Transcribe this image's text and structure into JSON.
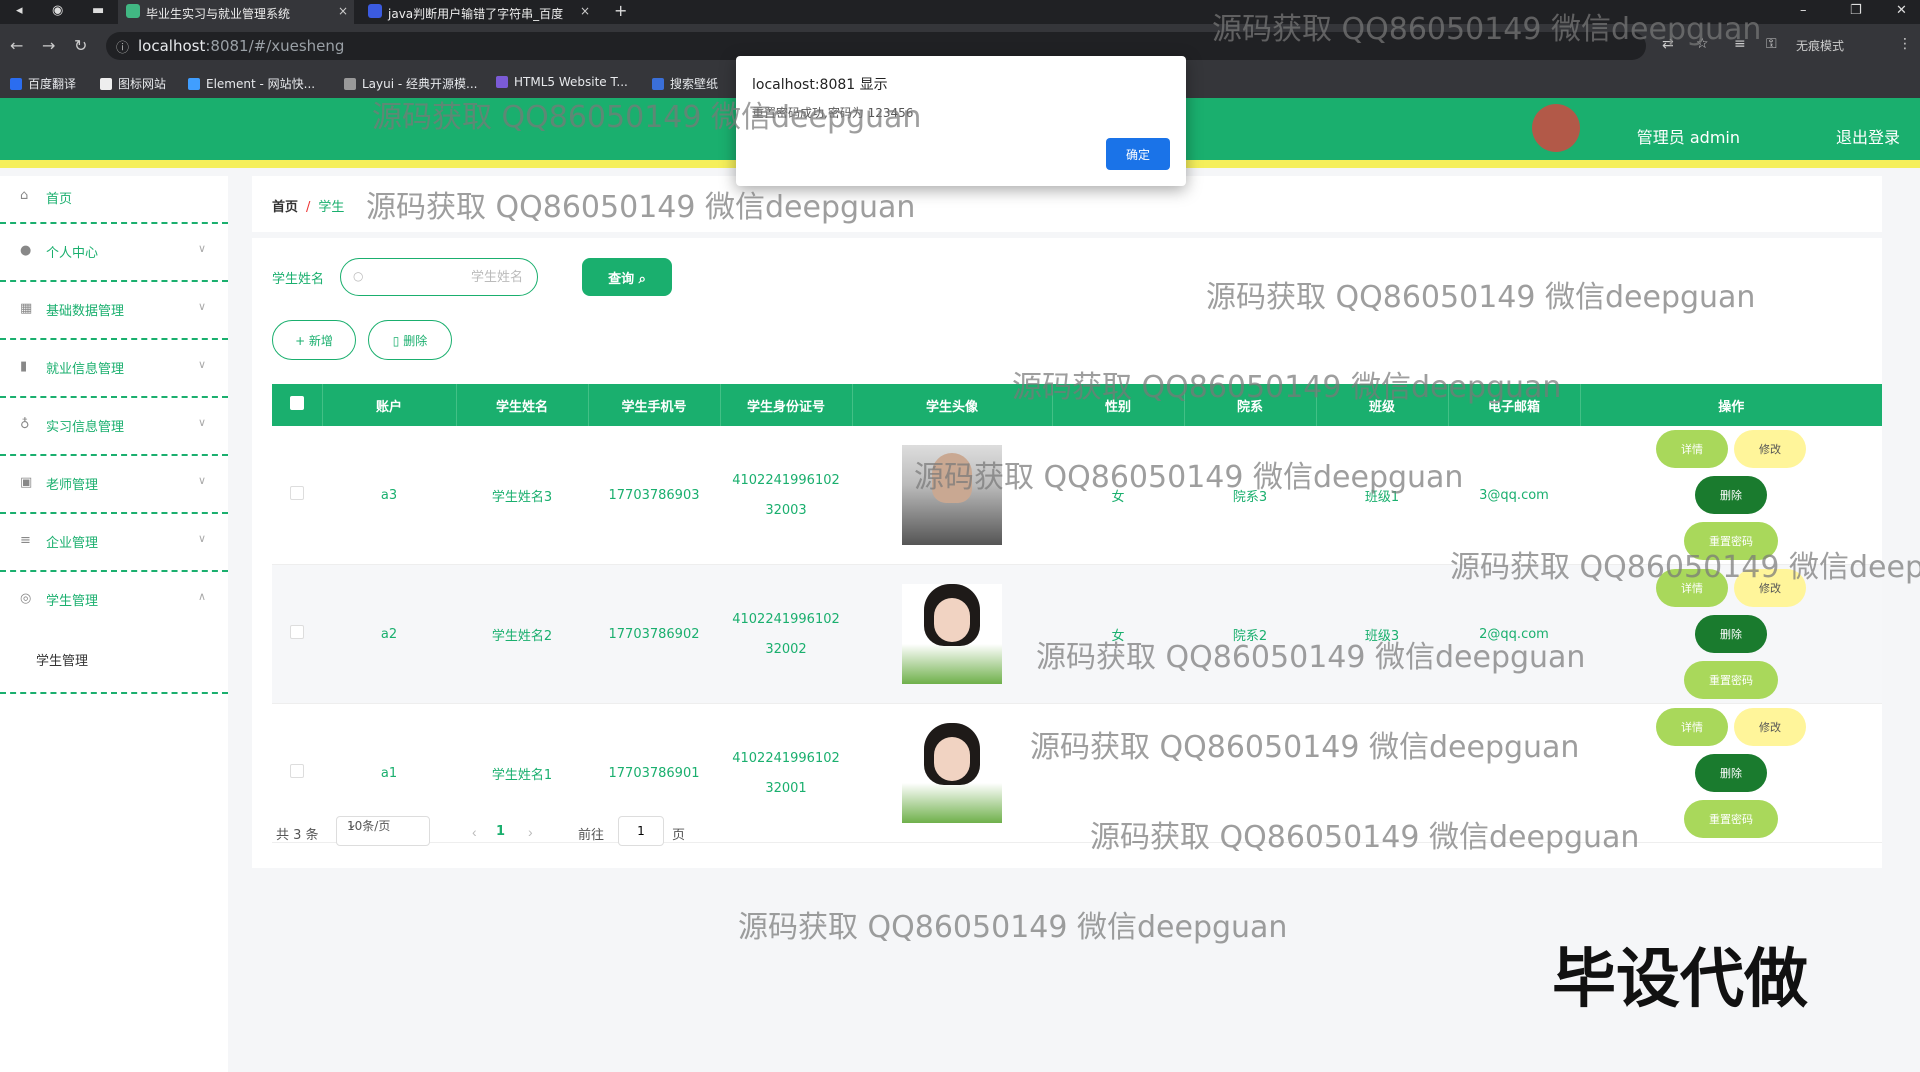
{
  "browser": {
    "tabs": [
      {
        "label": "毕业生实习与就业管理系统",
        "close": "×"
      },
      {
        "label": "java判断用户输错了字符串_百度",
        "close": "×"
      }
    ],
    "new_tab": "+",
    "url_host": "localhost",
    "url_rest": ":8081/#/xuesheng",
    "incognito": "无痕模式",
    "bookmarks": [
      "百度翻译",
      "图标网站",
      "Element - 网站快...",
      "Layui - 经典开源模...",
      "HTML5 Website T...",
      "搜索壁纸"
    ]
  },
  "alert": {
    "title": "localhost:8081 显示",
    "message": "重置密码成功,密码为 123456",
    "ok_label": "确定"
  },
  "header": {
    "user_label": "管理员 admin",
    "logout_label": "退出登录"
  },
  "sidebar": {
    "items": [
      {
        "label": "首页",
        "icon": "home-icon"
      },
      {
        "label": "个人中心",
        "icon": "user-icon"
      },
      {
        "label": "基础数据管理",
        "icon": "data-icon"
      },
      {
        "label": "就业信息管理",
        "icon": "chart-icon"
      },
      {
        "label": "实习信息管理",
        "icon": "mic-icon"
      },
      {
        "label": "老师管理",
        "icon": "teacher-icon"
      },
      {
        "label": "企业管理",
        "icon": "menu-icon"
      },
      {
        "label": "学生管理",
        "icon": "student-icon"
      }
    ],
    "sub_item": "学生管理"
  },
  "breadcrumb": {
    "home": "首页",
    "separator": "/",
    "current": "学生"
  },
  "search": {
    "label": "学生姓名",
    "placeholder": "学生姓名",
    "button": "查询"
  },
  "actions": {
    "add": "+ 新增",
    "delete": "删除"
  },
  "table": {
    "columns": [
      "账户",
      "学生姓名",
      "学生手机号",
      "学生身份证号",
      "学生头像",
      "性别",
      "院系",
      "班级",
      "电子邮箱",
      "操作"
    ],
    "rows": [
      {
        "account": "a3",
        "name": "学生姓名3",
        "phone": "17703786903",
        "id_a": "4102241996102",
        "id_b": "32003",
        "gender": "女",
        "dept": "院系3",
        "class": "班级1",
        "email": "3@qq.com"
      },
      {
        "account": "a2",
        "name": "学生姓名2",
        "phone": "17703786902",
        "id_a": "4102241996102",
        "id_b": "32002",
        "gender": "女",
        "dept": "院系2",
        "class": "班级3",
        "email": "2@qq.com"
      },
      {
        "account": "a1",
        "name": "学生姓名1",
        "phone": "17703786901",
        "id_a": "4102241996102",
        "id_b": "32001",
        "gender": "",
        "dept": "",
        "class": "",
        "email": ""
      }
    ],
    "op_labels": {
      "detail": "详情",
      "edit": "修改",
      "delete": "删除",
      "reset": "重置密码"
    }
  },
  "pager": {
    "total": "共 3 条",
    "page_size": "10条/页",
    "prev": "‹",
    "current": "1",
    "next": "›",
    "goto": "前往",
    "goto_value": "1",
    "page_unit": "页"
  },
  "watermark": "源码获取 QQ86050149 微信deepguan",
  "badge": "毕设代做",
  "colors": {
    "primary": "#1aaf6e",
    "header_stripe": "#f5ef5b",
    "detail": "#a9d85b",
    "edit": "#fff59a",
    "delete": "#1a7b2e"
  }
}
